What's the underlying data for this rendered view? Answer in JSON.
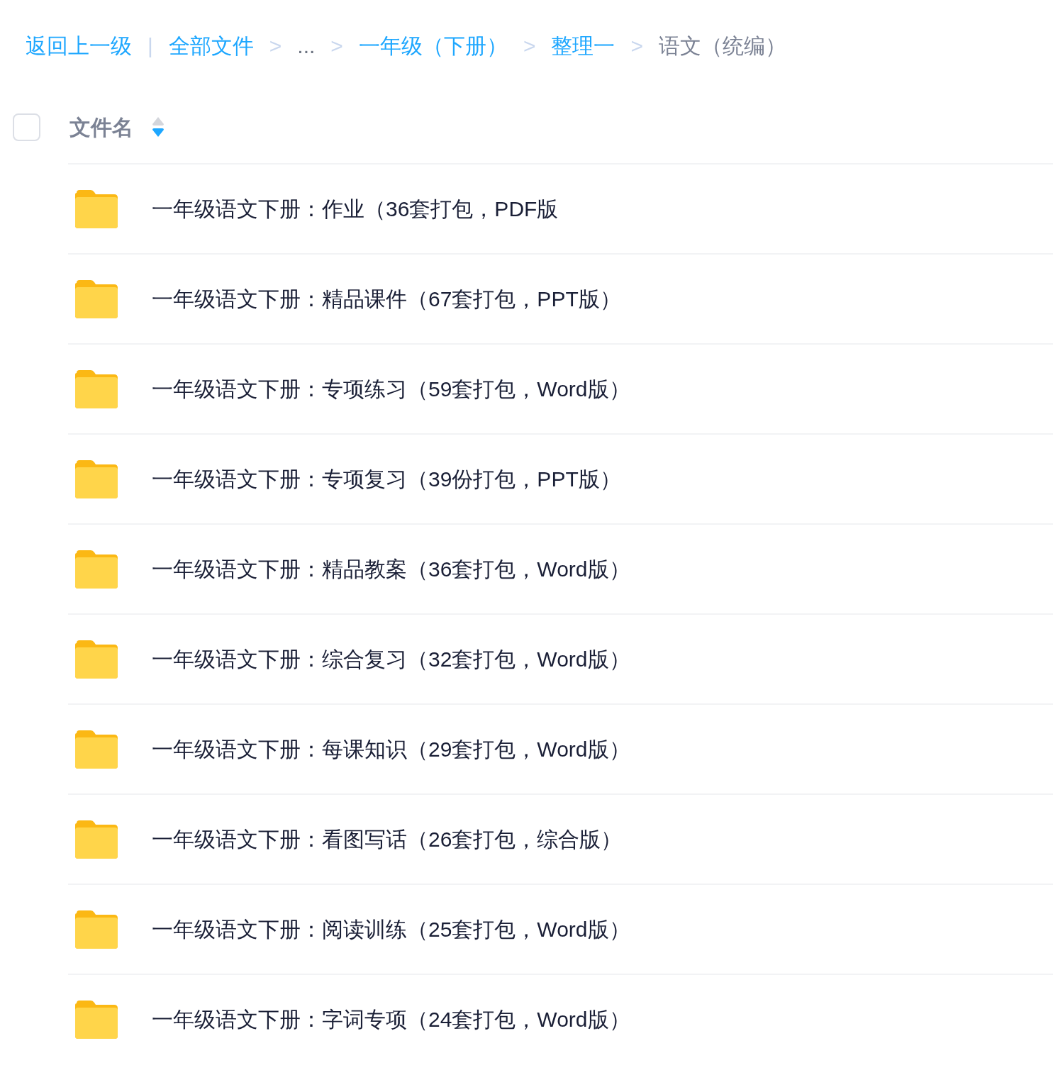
{
  "breadcrumb": {
    "back": "返回上一级",
    "divider": "|",
    "items": [
      {
        "label": "全部文件",
        "kind": "link"
      },
      {
        "label": "...",
        "kind": "ellipsis"
      },
      {
        "label": "一年级（下册）",
        "kind": "link"
      },
      {
        "label": "整理一",
        "kind": "link"
      },
      {
        "label": "语文（统编）",
        "kind": "current"
      }
    ],
    "separator": ">"
  },
  "header": {
    "checked": false,
    "column": "文件名",
    "sorted_descending": true
  },
  "rows": [
    {
      "name": "一年级语文下册：作业（36套打包，PDF版"
    },
    {
      "name": "一年级语文下册：精品课件（67套打包，PPT版）"
    },
    {
      "name": "一年级语文下册：专项练习（59套打包，Word版）"
    },
    {
      "name": "一年级语文下册：专项复习（39份打包，PPT版）"
    },
    {
      "name": "一年级语文下册：精品教案（36套打包，Word版）"
    },
    {
      "name": "一年级语文下册：综合复习（32套打包，Word版）"
    },
    {
      "name": "一年级语文下册：每课知识（29套打包，Word版）"
    },
    {
      "name": "一年级语文下册：看图写话（26套打包，综合版）"
    },
    {
      "name": "一年级语文下册：阅读训练（25套打包，Word版）"
    },
    {
      "name": "一年级语文下册：字词专项（24套打包，Word版）"
    }
  ]
}
